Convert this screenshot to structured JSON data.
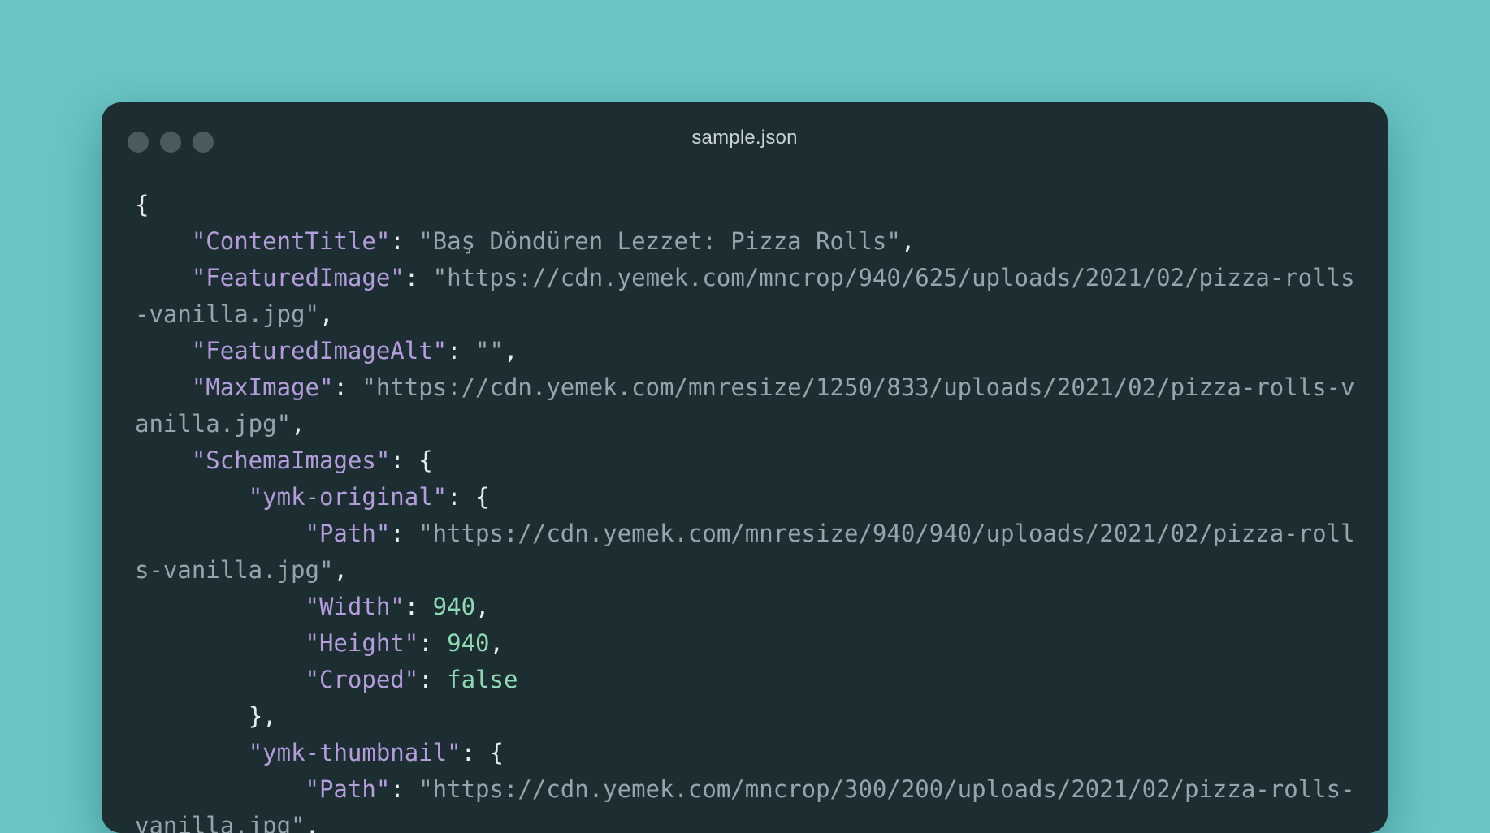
{
  "window": {
    "title": "sample.json",
    "controls": [
      "close",
      "minimize",
      "maximize"
    ]
  },
  "colors": {
    "background": "#6ac5c4",
    "window": "#1d2e33",
    "key": "#b39ddb",
    "string": "#97a4ad",
    "number": "#8fd9b5"
  },
  "code": {
    "open_brace": "{",
    "content_title_key": "\"ContentTitle\"",
    "content_title_val": "\"Baş Döndüren Lezzet: Pizza Rolls\"",
    "featured_image_key": "\"FeaturedImage\"",
    "featured_image_val": "\"https://cdn.yemek.com/mncrop/940/625/uploads/2021/02/pizza-rolls-vanilla.jpg\"",
    "featured_image_alt_key": "\"FeaturedImageAlt\"",
    "featured_image_alt_val": "\"\"",
    "max_image_key": "\"MaxImage\"",
    "max_image_val": "\"https://cdn.yemek.com/mnresize/1250/833/uploads/2021/02/pizza-rolls-vanilla.jpg\"",
    "schema_images_key": "\"SchemaImages\"",
    "ymk_original_key": "\"ymk-original\"",
    "orig_path_key": "\"Path\"",
    "orig_path_val": "\"https://cdn.yemek.com/mnresize/940/940/uploads/2021/02/pizza-rolls-vanilla.jpg\"",
    "orig_width_key": "\"Width\"",
    "orig_width_val": "940",
    "orig_height_key": "\"Height\"",
    "orig_height_val": "940",
    "orig_croped_key": "\"Croped\"",
    "orig_croped_val": "false",
    "close_obj": "},",
    "ymk_thumbnail_key": "\"ymk-thumbnail\"",
    "thumb_path_key": "\"Path\"",
    "thumb_path_val": "\"https://cdn.yemek.com/mncrop/300/200/uploads/2021/02/pizza-rolls-vanilla.jpg\""
  }
}
